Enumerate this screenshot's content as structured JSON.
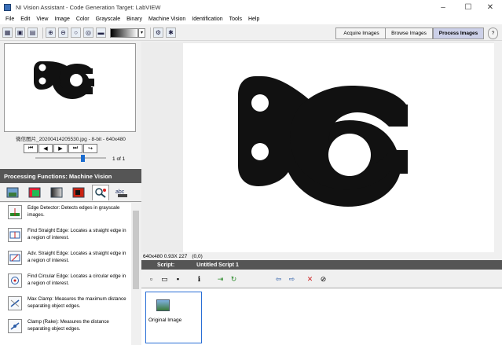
{
  "window": {
    "title": "NI Vision Assistant - Code Generation Target: LabVIEW",
    "min": "–",
    "max": "☐",
    "close": "✕"
  },
  "menu": [
    "File",
    "Edit",
    "View",
    "Image",
    "Color",
    "Grayscale",
    "Binary",
    "Machine Vision",
    "Identification",
    "Tools",
    "Help"
  ],
  "modes": {
    "acquire": "Acquire Images",
    "browse": "Browse Images",
    "process": "Process Images",
    "help": "?"
  },
  "thumbnail": {
    "caption": "微信图片_20200414205530.jpg - 8-bit - 640x480",
    "page": "1",
    "of": "of",
    "total": "1"
  },
  "navigation": {
    "first": "⏮",
    "prev": "◀",
    "next": "▶",
    "last": "⏭",
    "loop": "↪"
  },
  "processing": {
    "header": "Processing Functions: Machine Vision",
    "functions": [
      {
        "icon": "edge-detector-icon",
        "text": "Edge Detector:  Detects edges in grayscale images."
      },
      {
        "icon": "find-straight-edge-icon",
        "text": "Find Straight Edge:  Locates a straight edge in a region of interest."
      },
      {
        "icon": "adv-straight-edge-icon",
        "text": "Adv. Straight Edge:  Locates a straight edge in a region of interest."
      },
      {
        "icon": "find-circular-edge-icon",
        "text": "Find Circular Edge:  Locates a circular edge in a region of interest."
      },
      {
        "icon": "max-clamp-icon",
        "text": "Max Clamp:  Measures the maximum distance separating object edges."
      },
      {
        "icon": "clamp-rake-icon",
        "text": "Clamp (Rake):  Measures the distance separating object edges."
      }
    ]
  },
  "status": {
    "info": "640x480 0.93X 227",
    "coords": "(0,0)"
  },
  "script": {
    "label": "Script:",
    "name": "Untitled Script 1",
    "step_label": "Original Image"
  },
  "colors": {
    "panel_header": "#555555",
    "accent": "#2a6fd6"
  }
}
